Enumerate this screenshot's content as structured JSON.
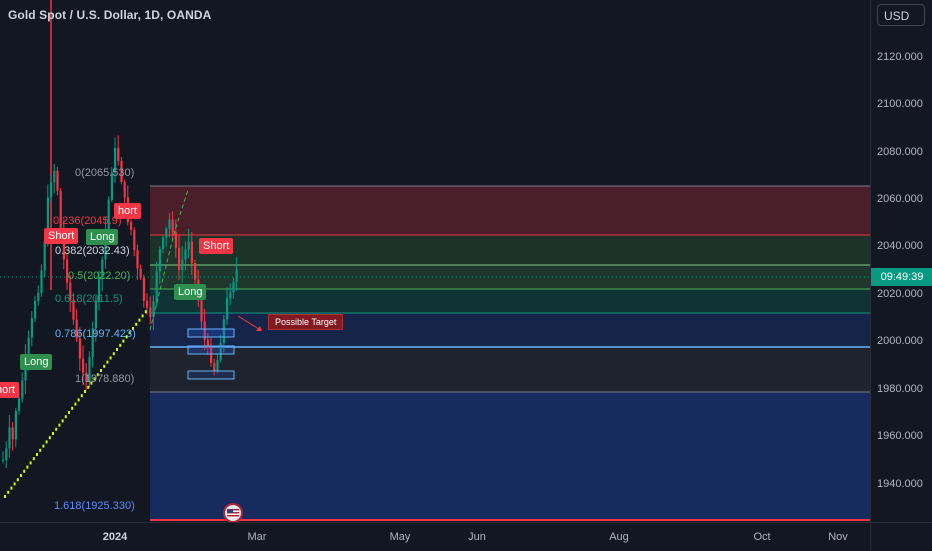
{
  "header": {
    "symbol_title": "Gold Spot / U.S. Dollar, 1D, OANDA",
    "currency_button": "USD"
  },
  "price_axis": {
    "ticks": [
      "2120.000",
      "2100.000",
      "2080.000",
      "2060.000",
      "2040.000",
      "2020.000",
      "2000.000",
      "1980.000",
      "1960.000",
      "1940.000"
    ],
    "current_price_timer": "09:49:39"
  },
  "time_axis": {
    "ticks": [
      "2024",
      "Mar",
      "May",
      "Jun",
      "Aug",
      "Oct",
      "Nov"
    ]
  },
  "fib_labels": [
    "0(2065.530)",
    "0.236(2045.9)",
    "0.382(2032.43)",
    "0.5(2022.20)",
    "0.618(2011.5)",
    "0.786(1997.423)",
    "1(1978.880)",
    "1.618(1925.330)"
  ],
  "trade_tags": {
    "short_1": "hort",
    "short_2": "Short",
    "short_3": "Short",
    "short_4": "hort",
    "long_1": "Long",
    "long_2": "Long",
    "long_3": "Long"
  },
  "annotation": {
    "possible_target": "Possible Target"
  },
  "colors": {
    "background": "#131722",
    "bull": "#089981",
    "bear": "#f23645",
    "fib_blue": "#2962ff",
    "fib_red": "#f23645",
    "fib_green": "#4caf50"
  },
  "icons": {
    "event_marker": "us-flag-icon"
  }
}
